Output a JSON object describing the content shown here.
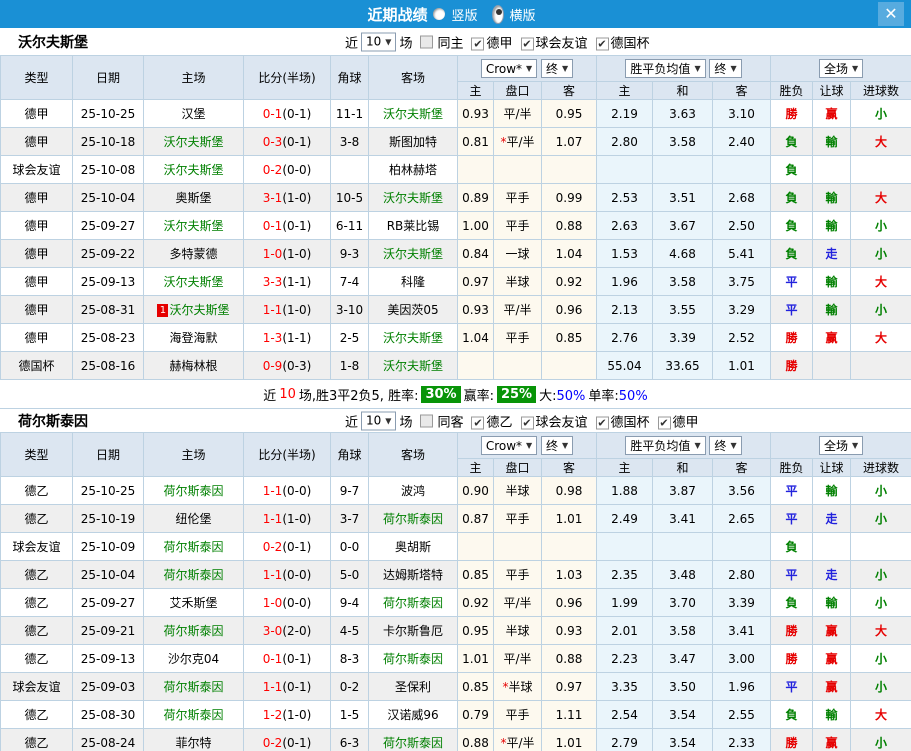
{
  "topbar": {
    "title": "近期战绩",
    "radio_vertical": "竖版",
    "radio_horizontal": "横版",
    "selected_layout": "横版",
    "close": "✕"
  },
  "colors": {
    "topbar_blue": "#1a90d5",
    "bundesliga_purple": "#990e9b",
    "liga2_magenta": "#c711c7",
    "friendly_teal": "#00a79b",
    "cup_darkred": "#a61c1c",
    "win_red": "#e60000",
    "lose_green": "#008000",
    "draw_blue": "#2222dd",
    "rate_green_bg": "#089408"
  },
  "columns": {
    "type": "类型",
    "date": "日期",
    "home": "主场",
    "score": "比分(半场)",
    "corner": "角球",
    "away": "客场",
    "odds1": [
      "主",
      "盘口",
      "客"
    ],
    "odds2": [
      "主",
      "和",
      "客"
    ],
    "result": [
      "胜负",
      "让球",
      "进球数"
    ]
  },
  "header_controls": {
    "bookmaker": "Crow*",
    "final1": "终",
    "avg": "胜平负均值",
    "final2": "终",
    "fullmatch": "全场"
  },
  "sections": [
    {
      "team": "沃尔夫斯堡",
      "filter": {
        "near": "近",
        "count": "10",
        "unit": "场",
        "same": "同主",
        "same_checked": false,
        "leagues": [
          {
            "label": "德甲",
            "checked": true
          },
          {
            "label": "球会友谊",
            "checked": true
          },
          {
            "label": "德国杯",
            "checked": true
          }
        ]
      },
      "rows": [
        {
          "type": "德甲",
          "date": "25-10-25",
          "home": "汉堡",
          "score": "0-1",
          "half": "(0-1)",
          "corner": "11-1",
          "away": "沃尔夫斯堡",
          "o1": [
            "0.93",
            "平/半",
            "0.95"
          ],
          "o2": [
            "2.19",
            "3.63",
            "3.10"
          ],
          "res": [
            "勝",
            "赢",
            "小"
          ]
        },
        {
          "type": "德甲",
          "date": "25-10-18",
          "home": "沃尔夫斯堡",
          "score": "0-3",
          "half": "(0-1)",
          "corner": "3-8",
          "away": "斯图加特",
          "o1": [
            "0.81",
            "*平/半",
            "1.07"
          ],
          "o2": [
            "2.80",
            "3.58",
            "2.40"
          ],
          "res": [
            "負",
            "輸",
            "大"
          ]
        },
        {
          "type": "球会友谊",
          "date": "25-10-08",
          "home": "沃尔夫斯堡",
          "score": "0-2",
          "half": "(0-0)",
          "corner": "",
          "away": "柏林赫塔",
          "o1": [
            "",
            "",
            ""
          ],
          "o2": [
            "",
            "",
            ""
          ],
          "res": [
            "負",
            "",
            ""
          ]
        },
        {
          "type": "德甲",
          "date": "25-10-04",
          "home": "奥斯堡",
          "score": "3-1",
          "half": "(1-0)",
          "corner": "10-5",
          "away": "沃尔夫斯堡",
          "o1": [
            "0.89",
            "平手",
            "0.99"
          ],
          "o2": [
            "2.53",
            "3.51",
            "2.68"
          ],
          "res": [
            "負",
            "輸",
            "大"
          ]
        },
        {
          "type": "德甲",
          "date": "25-09-27",
          "home": "沃尔夫斯堡",
          "score": "0-1",
          "half": "(0-1)",
          "corner": "6-11",
          "away": "RB莱比锡",
          "o1": [
            "1.00",
            "平手",
            "0.88"
          ],
          "o2": [
            "2.63",
            "3.67",
            "2.50"
          ],
          "res": [
            "負",
            "輸",
            "小"
          ]
        },
        {
          "type": "德甲",
          "date": "25-09-22",
          "home": "多特蒙德",
          "score": "1-0",
          "half": "(1-0)",
          "corner": "9-3",
          "away": "沃尔夫斯堡",
          "o1": [
            "0.84",
            "一球",
            "1.04"
          ],
          "o2": [
            "1.53",
            "4.68",
            "5.41"
          ],
          "res": [
            "負",
            "走",
            "小"
          ]
        },
        {
          "type": "德甲",
          "date": "25-09-13",
          "home": "沃尔夫斯堡",
          "score": "3-3",
          "half": "(1-1)",
          "corner": "7-4",
          "away": "科隆",
          "o1": [
            "0.97",
            "半球",
            "0.92"
          ],
          "o2": [
            "1.96",
            "3.58",
            "3.75"
          ],
          "res": [
            "平",
            "輸",
            "大"
          ]
        },
        {
          "type": "德甲",
          "date": "25-08-31",
          "home": "沃尔夫斯堡",
          "home_redcard": "1",
          "score": "1-1",
          "half": "(1-0)",
          "corner": "3-10",
          "away": "美因茨05",
          "o1": [
            "0.93",
            "平/半",
            "0.96"
          ],
          "o2": [
            "2.13",
            "3.55",
            "3.29"
          ],
          "res": [
            "平",
            "輸",
            "小"
          ]
        },
        {
          "type": "德甲",
          "date": "25-08-23",
          "home": "海登海默",
          "score": "1-3",
          "half": "(1-1)",
          "corner": "2-5",
          "away": "沃尔夫斯堡",
          "o1": [
            "1.04",
            "平手",
            "0.85"
          ],
          "o2": [
            "2.76",
            "3.39",
            "2.52"
          ],
          "res": [
            "勝",
            "赢",
            "大"
          ]
        },
        {
          "type": "德国杯",
          "date": "25-08-16",
          "home": "赫梅林根",
          "score": "0-9",
          "half": "(0-3)",
          "corner": "1-8",
          "away": "沃尔夫斯堡",
          "o1": [
            "",
            "",
            ""
          ],
          "o2": [
            "55.04",
            "33.65",
            "1.01"
          ],
          "res": [
            "勝",
            "",
            ""
          ]
        }
      ],
      "summary": {
        "pre": "近",
        "count": "10",
        "mid": "场,胜3平2负5, 胜率:",
        "win_pct": "30%",
        "label2": "赢率:",
        "win_pct2": "25%",
        "big_label": "大:",
        "big_pct": "50%",
        "single_label": "单率:",
        "single_pct": "50%"
      }
    },
    {
      "team": "荷尔斯泰因",
      "filter": {
        "near": "近",
        "count": "10",
        "unit": "场",
        "same": "同客",
        "same_checked": false,
        "leagues": [
          {
            "label": "德乙",
            "checked": true
          },
          {
            "label": "球会友谊",
            "checked": true
          },
          {
            "label": "德国杯",
            "checked": true
          },
          {
            "label": "德甲",
            "checked": true
          }
        ]
      },
      "rows": [
        {
          "type": "德乙",
          "date": "25-10-25",
          "home": "荷尔斯泰因",
          "score": "1-1",
          "half": "(0-0)",
          "corner": "9-7",
          "away": "波鸿",
          "o1": [
            "0.90",
            "半球",
            "0.98"
          ],
          "o2": [
            "1.88",
            "3.87",
            "3.56"
          ],
          "res": [
            "平",
            "輸",
            "小"
          ]
        },
        {
          "type": "德乙",
          "date": "25-10-19",
          "home": "纽伦堡",
          "score": "1-1",
          "half": "(1-0)",
          "corner": "3-7",
          "away": "荷尔斯泰因",
          "o1": [
            "0.87",
            "平手",
            "1.01"
          ],
          "o2": [
            "2.49",
            "3.41",
            "2.65"
          ],
          "res": [
            "平",
            "走",
            "小"
          ]
        },
        {
          "type": "球会友谊",
          "date": "25-10-09",
          "home": "荷尔斯泰因",
          "score": "0-2",
          "half": "(0-1)",
          "corner": "0-0",
          "away": "奥胡斯",
          "o1": [
            "",
            "",
            ""
          ],
          "o2": [
            "",
            "",
            ""
          ],
          "res": [
            "負",
            "",
            ""
          ]
        },
        {
          "type": "德乙",
          "date": "25-10-04",
          "home": "荷尔斯泰因",
          "score": "1-1",
          "half": "(0-0)",
          "corner": "5-0",
          "away": "达姆斯塔特",
          "o1": [
            "0.85",
            "平手",
            "1.03"
          ],
          "o2": [
            "2.35",
            "3.48",
            "2.80"
          ],
          "res": [
            "平",
            "走",
            "小"
          ]
        },
        {
          "type": "德乙",
          "date": "25-09-27",
          "home": "艾禾斯堡",
          "score": "1-0",
          "half": "(0-0)",
          "corner": "9-4",
          "away": "荷尔斯泰因",
          "o1": [
            "0.92",
            "平/半",
            "0.96"
          ],
          "o2": [
            "1.99",
            "3.70",
            "3.39"
          ],
          "res": [
            "負",
            "輸",
            "小"
          ]
        },
        {
          "type": "德乙",
          "date": "25-09-21",
          "home": "荷尔斯泰因",
          "score": "3-0",
          "half": "(2-0)",
          "corner": "4-5",
          "away": "卡尔斯鲁厄",
          "o1": [
            "0.95",
            "半球",
            "0.93"
          ],
          "o2": [
            "2.01",
            "3.58",
            "3.41"
          ],
          "res": [
            "勝",
            "赢",
            "大"
          ]
        },
        {
          "type": "德乙",
          "date": "25-09-13",
          "home": "沙尔克04",
          "score": "0-1",
          "half": "(0-1)",
          "corner": "8-3",
          "away": "荷尔斯泰因",
          "o1": [
            "1.01",
            "平/半",
            "0.88"
          ],
          "o2": [
            "2.23",
            "3.47",
            "3.00"
          ],
          "res": [
            "勝",
            "赢",
            "小"
          ]
        },
        {
          "type": "球会友谊",
          "date": "25-09-03",
          "home": "荷尔斯泰因",
          "score": "1-1",
          "half": "(0-1)",
          "corner": "0-2",
          "away": "圣保利",
          "o1": [
            "0.85",
            "*半球",
            "0.97"
          ],
          "o2": [
            "3.35",
            "3.50",
            "1.96"
          ],
          "res": [
            "平",
            "赢",
            "小"
          ]
        },
        {
          "type": "德乙",
          "date": "25-08-30",
          "home": "荷尔斯泰因",
          "score": "1-2",
          "half": "(1-0)",
          "corner": "1-5",
          "away": "汉诺威96",
          "o1": [
            "0.79",
            "平手",
            "1.11"
          ],
          "o2": [
            "2.54",
            "3.54",
            "2.55"
          ],
          "res": [
            "負",
            "輸",
            "大"
          ]
        },
        {
          "type": "德乙",
          "date": "25-08-24",
          "home": "菲尔特",
          "score": "0-2",
          "half": "(0-1)",
          "corner": "6-3",
          "away": "荷尔斯泰因",
          "o1": [
            "0.88",
            "*平/半",
            "1.01"
          ],
          "o2": [
            "2.79",
            "3.54",
            "2.33"
          ],
          "res": [
            "勝",
            "赢",
            "小"
          ]
        }
      ]
    }
  ]
}
